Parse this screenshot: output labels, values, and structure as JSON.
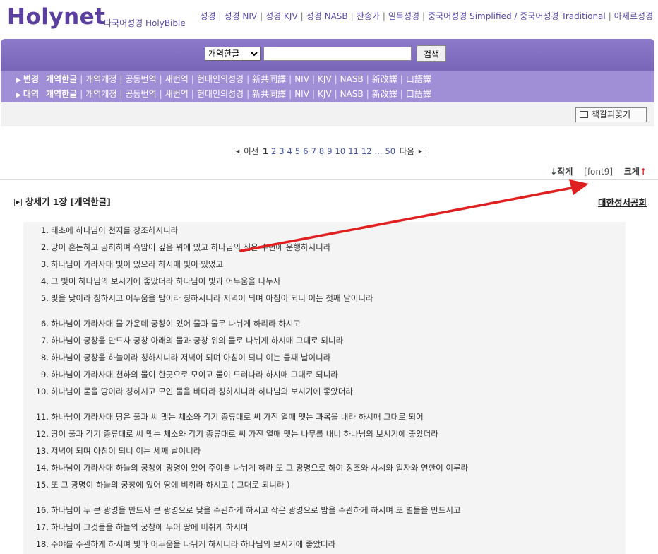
{
  "site": {
    "logo": "Holynet",
    "subtitle": "다국어성경 HolyBible",
    "topnav": [
      "성경",
      "성경 NIV",
      "성경 KJV",
      "성경 NASB",
      "찬송가",
      "일독성경",
      "중국어성경 Simplified / 중국어성경 Traditional",
      "아제르성경"
    ]
  },
  "search": {
    "select_value": "개역한글",
    "input_value": "",
    "button_label": "검색"
  },
  "versions": {
    "row1_label": "변경",
    "row2_label": "대역",
    "items": [
      "개역한글",
      "개역개정",
      "공동번역",
      "새번역",
      "현대인의성경",
      "新共同譯",
      "NIV",
      "KJV",
      "NASB",
      "新改譯",
      "口語譯"
    ],
    "current": "개역한글"
  },
  "bookmark_button": "책갈피꽂기",
  "pager": {
    "prev": "이전",
    "next": "다음",
    "pages": [
      "1",
      "2",
      "3",
      "4",
      "5",
      "6",
      "7",
      "8",
      "9",
      "10",
      "11",
      "12",
      "...",
      "50"
    ],
    "current": "1"
  },
  "font": {
    "smaller": "작게",
    "current": "[font9]",
    "bigger": "크게"
  },
  "chapter": {
    "title": "창세기 1장 [개역한글]",
    "publisher": "대한성서공회"
  },
  "verses": [
    {
      "n": "1.",
      "t": "태초에 하나님이 천지를 창조하시니라"
    },
    {
      "n": "2.",
      "t": "땅이 혼돈하고 공허하며 흑암이 깊음 위에 있고 하나님의 신은 수면에 운행하시니라"
    },
    {
      "n": "3.",
      "t": "하나님이 가라사대 빛이 있으라 하시매 빛이 있었고"
    },
    {
      "n": "4.",
      "t": "그 빛이 하나님의 보시기에 좋았더라 하나님이 빛과 어두움을 나누사"
    },
    {
      "n": "5.",
      "t": "빛을 낮이라 칭하시고 어두움을 밤이라 칭하시니라 저녁이 되며 아침이 되니 이는 첫째 날이니라"
    },
    {
      "n": "6.",
      "t": "하나님이 가라사대 물 가운데 궁창이 있어 물과 물로 나뉘게 하리라 하시고"
    },
    {
      "n": "7.",
      "t": "하나님이 궁창을 만드사 궁창 아래의 물과 궁창 위의 물로 나뉘게 하시매 그대로 되니라"
    },
    {
      "n": "8.",
      "t": "하나님이 궁창을 하늘이라 칭하시니라 저녁이 되며 아침이 되니 이는 둘째 날이니라"
    },
    {
      "n": "9.",
      "t": "하나님이 가라사대 천하의 물이 한곳으로 모이고 뭍이 드러나라 하시매 그대로 되니라"
    },
    {
      "n": "10.",
      "t": "하나님이 뭍을 땅이라 칭하시고 모인 물을 바다라 칭하시니라 하나님의 보시기에 좋았더라"
    },
    {
      "n": "11.",
      "t": "하나님이 가라사대 땅은 풀과 씨 맺는 채소와 각기 종류대로 씨 가진 열매 맺는 과목을 내라 하시매 그대로 되어"
    },
    {
      "n": "12.",
      "t": "땅이 풀과 각기 종류대로 씨 맺는 채소와 각기 종류대로 씨 가진 열매 맺는 나무를 내니 하나님의 보시기에 좋았더라"
    },
    {
      "n": "13.",
      "t": "저녁이 되며 아침이 되니 이는 세째 날이니라"
    },
    {
      "n": "14.",
      "t": "하나님이 가라사대 하늘의 궁창에 광명이 있어 주야를 나뉘게 하라 또 그 광명으로 하여 징조와 사시와 일자와 연한이 이루라"
    },
    {
      "n": "15.",
      "t": "또 그 광명이 하늘의 궁창에 있어 땅에 비취라 하시고 ( 그대로 되니라 )"
    },
    {
      "n": "16.",
      "t": "하나님이 두 큰 광명을 만드사 큰 광명으로 낮을 주관하게 하시고 작은 광명으로 밤을 주관하게 하시며 또 별들을 만드시고"
    },
    {
      "n": "17.",
      "t": "하나님이 그것들을 하늘의 궁창에 두어 땅에 비취게 하시며"
    },
    {
      "n": "18.",
      "t": "주야를 주관하게 하시며 빛과 어두움을 나뉘게 하시니라 하나님의 보시기에 좋았더라"
    }
  ],
  "colors": {
    "brand": "#5a3fa0",
    "band": "#8d79c9",
    "version_bar": "#a08fd6",
    "annotation_arrow": "#e02020"
  }
}
